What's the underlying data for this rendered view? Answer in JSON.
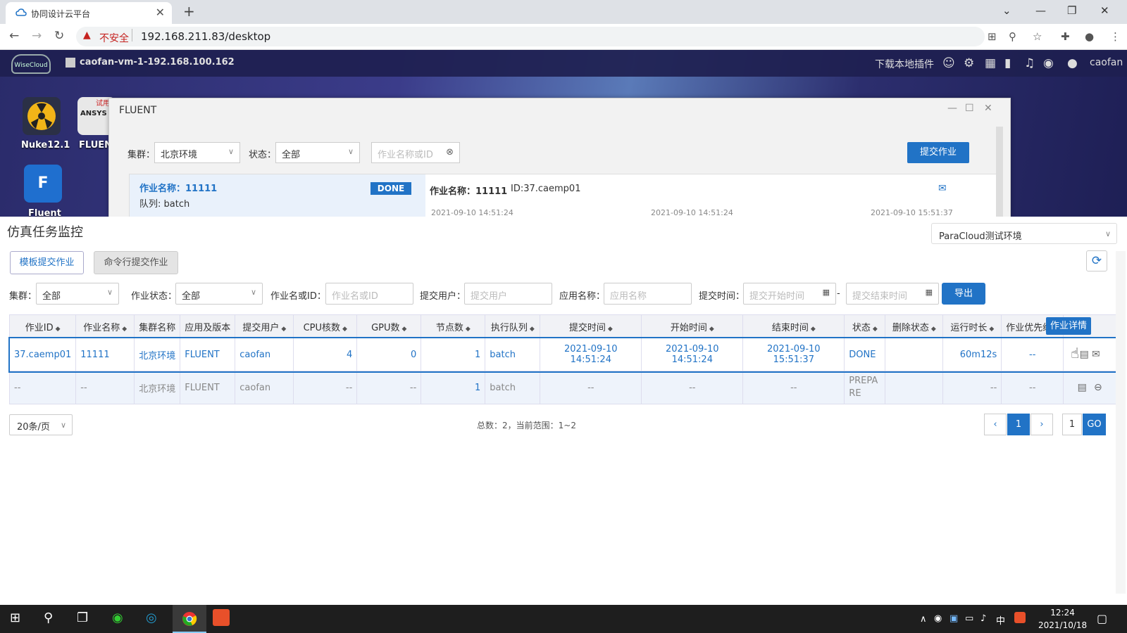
{
  "browser": {
    "tab_title": "协同设计云平台",
    "tab_close": "✕",
    "new_tab": "+",
    "security_label": "不安全",
    "url": "192.168.211.83/desktop"
  },
  "desktop": {
    "vm_name": "caofan-vm-1-192.168.100.162",
    "plugin_label": "下载本地插件",
    "username": "caofan",
    "logo_text": "WiseCloud",
    "apps": [
      {
        "label": "Nuke12.1"
      },
      {
        "label": "FLUENT",
        "badge": "试用",
        "logo": "ANSYS"
      },
      {
        "label": "Fluent",
        "glyph": "F"
      }
    ]
  },
  "fluent_window": {
    "title": "FLUENT",
    "cluster_label": "集群：",
    "cluster_value": "北京环境",
    "status_label": "状态：",
    "status_value": "全部",
    "search_placeholder": "作业名称或ID",
    "submit_button": "提交作业",
    "card": {
      "job_name": "作业名称：11111",
      "queue": "队列: batch",
      "status": "DONE",
      "detail_name": "作业名称：11111",
      "detail_id": "ID:37.caemp01",
      "time1": "2021-09-10 14:51:24",
      "time2": "2021-09-10 14:51:24",
      "time3": "2021-09-10 15:51:37"
    }
  },
  "monitor": {
    "title": "仿真任务监控",
    "env_select": "ParaCloud测试环境",
    "tabs": [
      {
        "label": "模板提交作业",
        "active": true
      },
      {
        "label": "命令行提交作业",
        "active": false
      }
    ],
    "filters": {
      "cluster_label": "集群：",
      "cluster_value": "全部",
      "job_status_label": "作业状态：",
      "job_status_value": "全部",
      "job_name_label": "作业名或ID：",
      "job_name_placeholder": "作业名或ID",
      "user_label": "提交用户：",
      "user_placeholder": "提交用户",
      "app_label": "应用名称：",
      "app_placeholder": "应用名称",
      "time_label": "提交时间：",
      "start_placeholder": "提交开始时间",
      "dash": "-",
      "end_placeholder": "提交结束时间",
      "export_button": "导出"
    },
    "columns": [
      "作业ID",
      "作业名称",
      "集群名称",
      "应用及版本",
      "提交用户",
      "CPU核数",
      "GPU数",
      "节点数",
      "执行队列",
      "提交时间",
      "开始时间",
      "结束时间",
      "状态",
      "删除状态",
      "运行时长",
      "作业优先级",
      ""
    ],
    "rows": [
      [
        "37.caemp01",
        "11111",
        "北京环境",
        "FLUENT",
        "caofan",
        "4",
        "0",
        "1",
        "batch",
        "2021-09-10 14:51:24",
        "2021-09-10 14:51:24",
        "2021-09-10 15:51:37",
        "DONE",
        "",
        "60m12s",
        "--"
      ],
      [
        "--",
        "--",
        "北京环境",
        "FLUENT",
        "caofan",
        "--",
        "--",
        "1",
        "batch",
        "--",
        "--",
        "--",
        "PREPARE",
        "",
        "--",
        "--"
      ]
    ],
    "tooltip": "作业详情",
    "page_size": "20条/页",
    "total_text": "总数：2，当前范围：1~2",
    "current_page": "1",
    "goto_value": "1",
    "go_button": "GO"
  },
  "taskbar": {
    "time": "12:24",
    "date": "2021/10/18",
    "ime": "中"
  },
  "colors": {
    "accent": "#2173c6",
    "done_badge": "#2173c6"
  }
}
